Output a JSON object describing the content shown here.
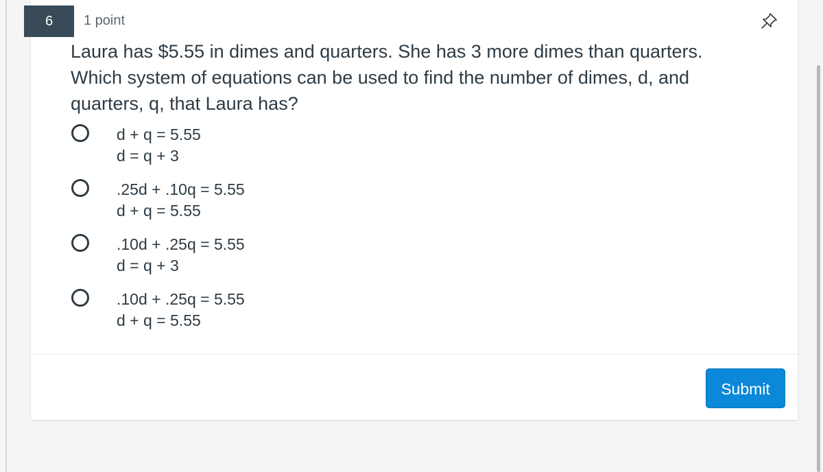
{
  "question": {
    "number": "6",
    "points": "1 point",
    "text": "Laura has $5.55 in dimes and quarters.  She has 3 more dimes than quarters. Which system of equations can be used to find the number of dimes, d, and quarters, q, that Laura has?",
    "pin_icon": "pin-icon"
  },
  "answers": [
    {
      "line1": "d + q = 5.55",
      "line2": "d = q + 3"
    },
    {
      "line1": ".25d + .10q = 5.55",
      "line2": "d + q = 5.55"
    },
    {
      "line1": ".10d + .25q = 5.55",
      "line2": "d = q + 3"
    },
    {
      "line1": ".10d + .25q = 5.55",
      "line2": "d + q = 5.55"
    }
  ],
  "submit_label": "Submit",
  "colors": {
    "qnum_bg": "#394b58",
    "text": "#2d3b45",
    "submit_bg": "#0b88d8",
    "page_bg": "#f5f5f5"
  }
}
